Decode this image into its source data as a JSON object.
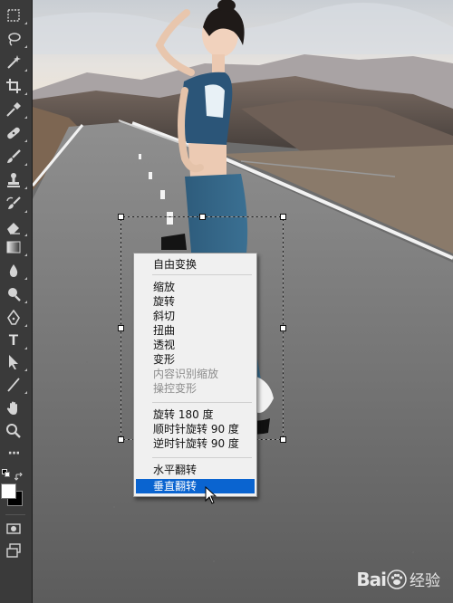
{
  "toolbar": {
    "tools": [
      "rect-marquee-icon",
      "lasso-icon",
      "magic-wand-icon",
      "crop-icon",
      "eyedropper-icon",
      "healing-brush-icon",
      "brush-icon",
      "clone-stamp-icon",
      "history-brush-icon",
      "eraser-icon",
      "gradient-icon",
      "blur-drop-icon",
      "dodge-icon",
      "pen-icon",
      "type-icon",
      "path-select-icon",
      "line-icon",
      "hand-icon",
      "zoom-icon",
      "more-tools-icon"
    ],
    "type_tool_glyph": "T",
    "more_tools_glyph": "···",
    "foreground_color": "#ffffff",
    "background_color": "#000000"
  },
  "context_menu": {
    "items": [
      {
        "label": "自由变换",
        "state": "normal"
      },
      {
        "label": "缩放",
        "state": "normal"
      },
      {
        "label": "旋转",
        "state": "normal"
      },
      {
        "label": "斜切",
        "state": "normal"
      },
      {
        "label": "扭曲",
        "state": "normal"
      },
      {
        "label": "透视",
        "state": "normal"
      },
      {
        "label": "变形",
        "state": "normal"
      },
      {
        "label": "内容识别缩放",
        "state": "disabled"
      },
      {
        "label": "操控变形",
        "state": "disabled"
      },
      {
        "label": "旋转 180 度",
        "state": "normal"
      },
      {
        "label": "顺时针旋转 90 度",
        "state": "normal"
      },
      {
        "label": "逆时针旋转 90 度",
        "state": "normal"
      },
      {
        "label": "水平翻转",
        "state": "normal"
      },
      {
        "label": "垂直翻转",
        "state": "highlighted"
      }
    ],
    "highlight_color": "#0a64d0"
  },
  "watermark": {
    "left": "Bai",
    "right": "经验"
  }
}
